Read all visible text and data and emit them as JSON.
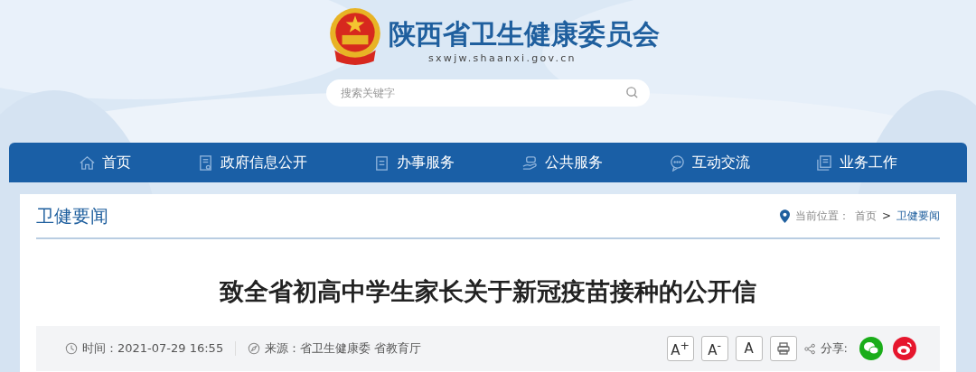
{
  "header": {
    "title": "陕西省卫生健康委员会",
    "url": "sxwjw.shaanxi.gov.cn",
    "search": {
      "placeholder": "搜索关键字"
    }
  },
  "nav": [
    {
      "label": "首页",
      "kind": "home"
    },
    {
      "label": "政府信息公开",
      "kind": "doc"
    },
    {
      "label": "办事服务",
      "kind": "clipboard"
    },
    {
      "label": "公共服务",
      "kind": "hand"
    },
    {
      "label": "互动交流",
      "kind": "chat"
    },
    {
      "label": "业务工作",
      "kind": "book"
    }
  ],
  "section": {
    "title": "卫健要闻",
    "breadcrumb": {
      "label": "当前位置：",
      "items": [
        "首页",
        "卫健要闻"
      ],
      "separator": ">"
    }
  },
  "article": {
    "title": "致全省初高中学生家长关于新冠疫苗接种的公开信",
    "time_label": "时间：",
    "time": "2021-07-29 16:55",
    "source_label": "来源：",
    "source": "省卫生健康委 省教育厅",
    "font_buttons": [
      "A$^{+}$",
      "A$^{-}$",
      "A"
    ],
    "share_label": "分享:"
  }
}
